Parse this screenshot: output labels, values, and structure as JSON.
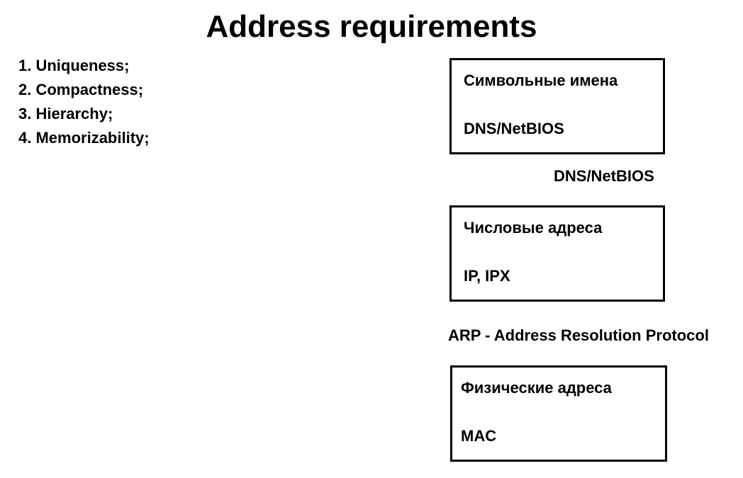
{
  "title": "Address requirements",
  "requirements": [
    "1. Uniqueness;",
    "2. Compactness;",
    "3. Hierarchy;",
    "4. Memorizability;"
  ],
  "boxes": [
    {
      "heading": "Символьные имена",
      "value": "DNS/NetBIOS"
    },
    {
      "heading": "Числовые адреса",
      "value": "IP, IPX"
    },
    {
      "heading": "Физические адреса",
      "value": "MAC"
    }
  ],
  "connectors": [
    "DNS/NetBIOS",
    "ARP - Address Resolution Protocol"
  ]
}
